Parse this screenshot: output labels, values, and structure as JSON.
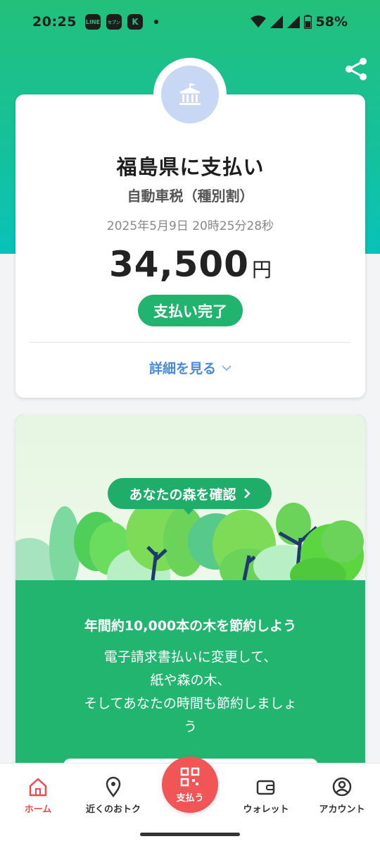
{
  "status_bar": {
    "time": "20:25",
    "app_icons": [
      "LINE",
      "セブン",
      "K"
    ],
    "battery": "58%"
  },
  "receipt": {
    "payee": "福島県に支払い",
    "subtitle": "自動車税（種別割）",
    "datetime": "2025年5月9日 20時25分28秒",
    "amount": "34,500",
    "currency": "円",
    "status": "支払い完了",
    "details_link": "詳細を見る"
  },
  "forest": {
    "button_label": "あなたの森を確認",
    "headline": "年間約10,000本の木を節約しよう",
    "body_lines": [
      "電子請求書払いに変更して、",
      "紙や森の木、",
      "そしてあなたの時間も節約しましょ",
      "う"
    ]
  },
  "nav": {
    "home": "ホーム",
    "nearby": "近くのおトク",
    "pay": "支払う",
    "wallet": "ウォレット",
    "account": "アカウント"
  },
  "colors": {
    "brand_green": "#22c07a",
    "status_pill": "#21b46e",
    "link_blue": "#4a8ad8",
    "pay_red": "#f25555"
  }
}
